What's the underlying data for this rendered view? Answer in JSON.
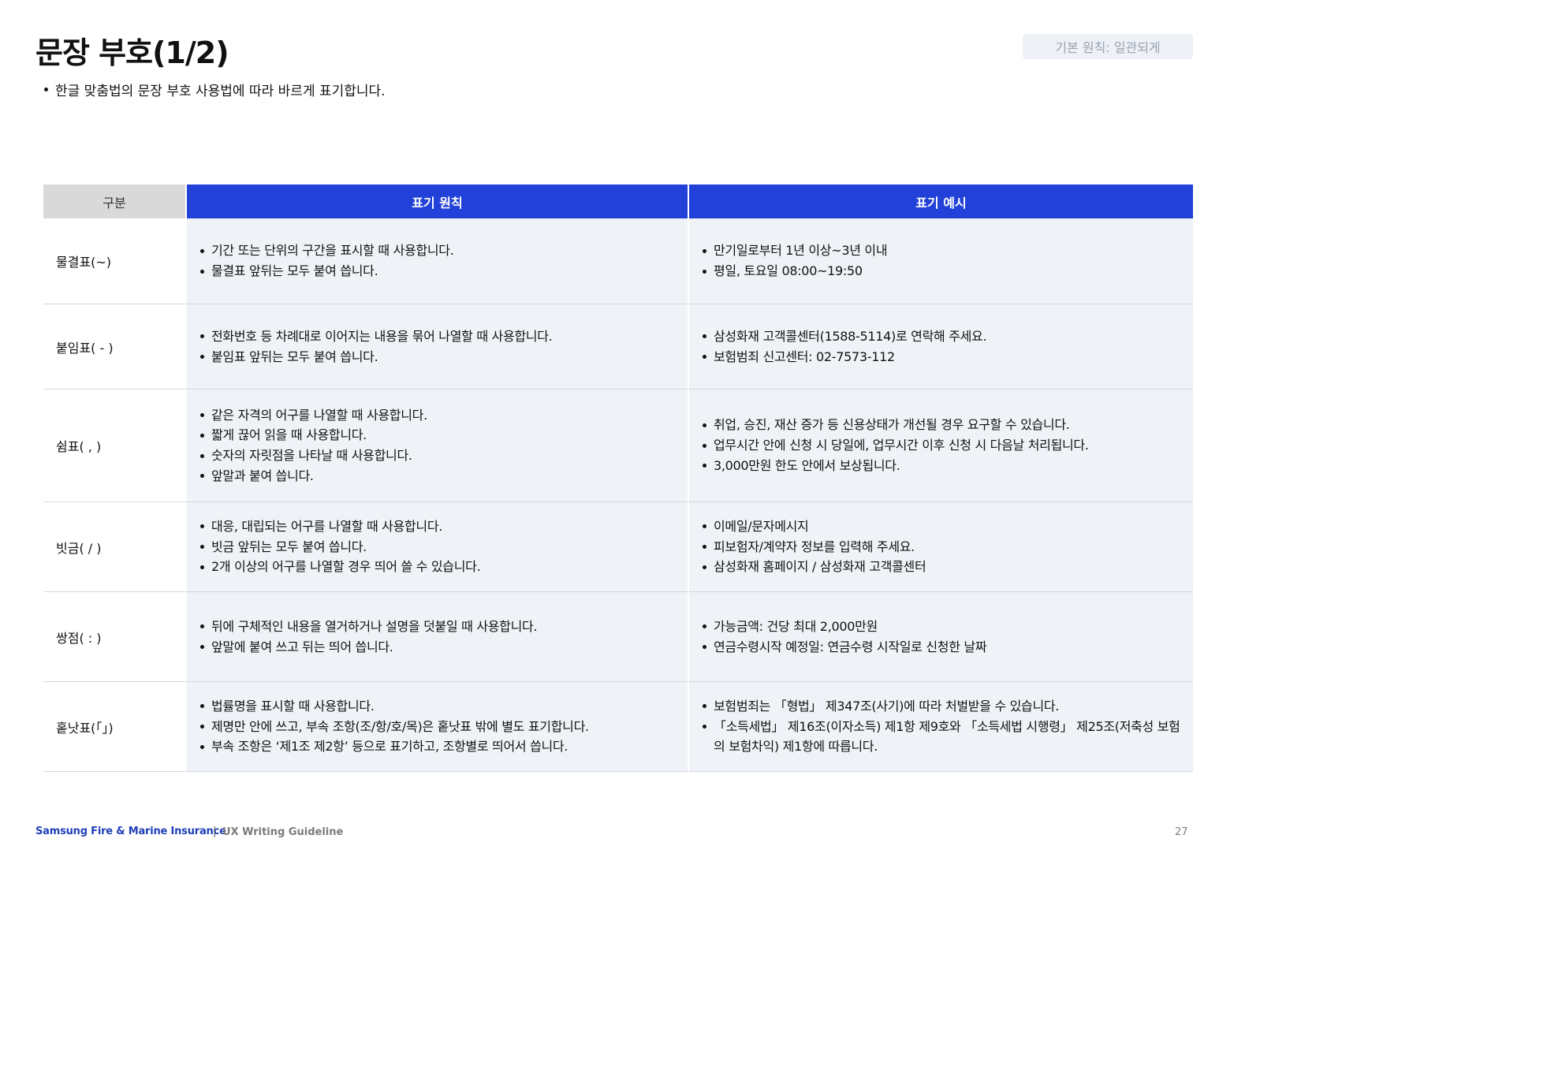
{
  "header": {
    "title": "문장 부호(1/2)",
    "principle_badge": "기본 원칙: 일관되게",
    "intro": "한글 맞춤법의 문장 부호 사용법에 따라 바르게 표기합니다."
  },
  "table": {
    "columns": [
      "구분",
      "표기 원칙",
      "표기 예시"
    ],
    "rows": [
      {
        "category": "물결표(~)",
        "rules": [
          "기간 또는 단위의 구간을 표시할 때 사용합니다.",
          "물결표 앞뒤는 모두 붙여 씁니다."
        ],
        "examples": [
          "만기일로부터 1년 이상~3년 이내",
          "평일, 토요일 08:00~19:50"
        ]
      },
      {
        "category": "붙임표( - )",
        "rules": [
          "전화번호 등 차례대로 이어지는 내용을 묶어 나열할 때 사용합니다.",
          "붙임표 앞뒤는 모두 붙여 씁니다."
        ],
        "examples": [
          "삼성화재 고객콜센터(1588-5114)로 연락해 주세요.",
          "보험범죄 신고센터: 02-7573-112"
        ]
      },
      {
        "category": "쉼표( , )",
        "rules": [
          "같은 자격의 어구를 나열할 때 사용합니다.",
          "짧게 끊어 읽을 때 사용합니다.",
          "숫자의 자릿점을 나타날 때 사용합니다.",
          "앞말과 붙여 씁니다."
        ],
        "examples": [
          "취업, 승진, 재산 증가 등 신용상태가 개선될 경우 요구할 수 있습니다.",
          "업무시간 안에 신청 시 당일에, 업무시간 이후 신청 시 다음날 처리됩니다.",
          "3,000만원 한도 안에서 보상됩니다."
        ]
      },
      {
        "category": "빗금( / )",
        "rules": [
          "대응, 대립되는 어구를 나열할 때 사용합니다.",
          "빗금 앞뒤는 모두 붙여 씁니다.",
          "2개 이상의 어구를 나열할 경우 띄어 쓸 수 있습니다."
        ],
        "examples": [
          "이메일/문자메시지",
          "피보험자/계약자 정보를 입력해 주세요.",
          "삼성화재 홈페이지 / 삼성화재 고객콜센터"
        ]
      },
      {
        "category": "쌍점( : )",
        "rules": [
          "뒤에 구체적인 내용을 열거하거나 설명을 덧붙일 때 사용합니다.",
          "앞말에 붙여 쓰고 뒤는 띄어 씁니다."
        ],
        "examples": [
          "가능금액: 건당 최대 2,000만원",
          "연금수령시작 예정일: 연금수령 시작일로 신청한 날짜"
        ]
      },
      {
        "category": "홑낫표(「」)",
        "rules": [
          "법률명을 표시할 때 사용합니다.",
          "제명만 안에 쓰고, 부속 조항(조/항/호/목)은 홑낫표 밖에 별도 표기합니다.",
          "부속 조항은 ‘제1조 제2항’ 등으로 표기하고, 조항별로 띄어서 씁니다."
        ],
        "examples": [
          "보험범죄는 「형법」 제347조(사기)에 따라 처벌받을 수 있습니다.",
          "「소득세법」 제16조(이자소득) 제1항 제9호와 「소득세법 시행령」 제25조(저축성 보험의 보험차익) 제1항에 따릅니다."
        ]
      }
    ]
  },
  "footer": {
    "brand": "Samsung Fire & Marine Insurance",
    "separator": "|",
    "guide": "UX Writing Guideline",
    "page_number": "27"
  },
  "colors": {
    "accent_blue": "#2241d8",
    "cell_background": "#eff2f7",
    "header_gray": "#d9d9d9",
    "brand_blue": "#1f3fb8"
  }
}
